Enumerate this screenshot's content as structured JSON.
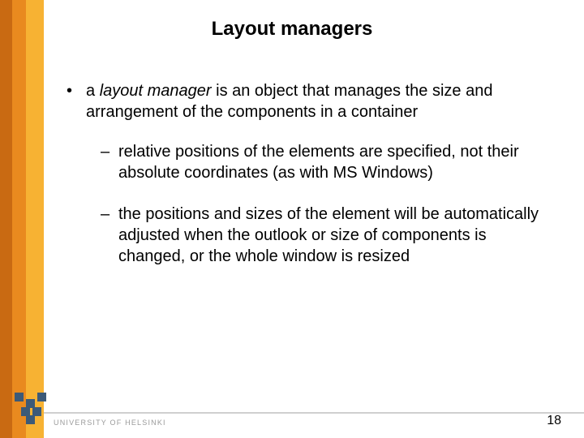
{
  "slide": {
    "title": "Layout managers",
    "bullets": [
      {
        "level": 1,
        "text_prefix": "a ",
        "emph": "layout manager",
        "text_suffix": " is an object that manages the size and arrangement of the components in a container"
      },
      {
        "level": 2,
        "text": "relative positions of the elements are specified, not their absolute coordinates (as with MS Windows)"
      },
      {
        "level": 2,
        "text": "the positions and sizes of the element will be automatically adjusted when the outlook or size of components is changed, or the whole window is resized"
      }
    ],
    "footer": {
      "institution": "UNIVERSITY OF HELSINKI",
      "page_number": "18"
    },
    "accent_colors": {
      "orange_light": "#f7b233",
      "orange_mid": "#e98a1f",
      "orange_dark": "#c96a12"
    }
  }
}
